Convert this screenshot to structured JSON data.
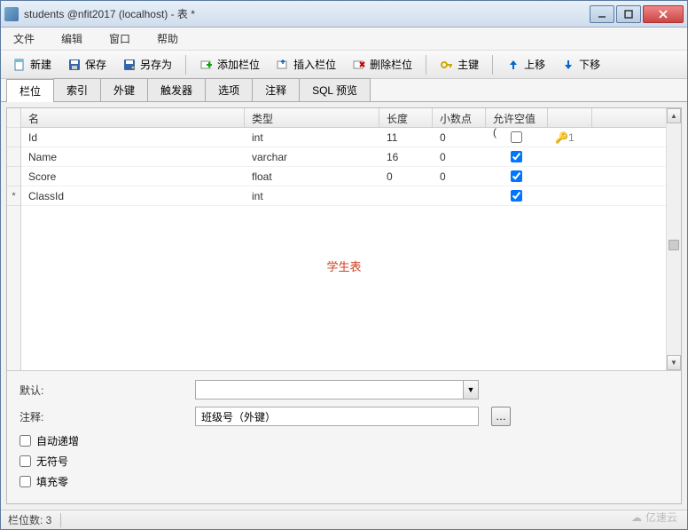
{
  "window": {
    "title": "students @nfit2017 (localhost) - 表 *"
  },
  "menu": {
    "file": "文件",
    "edit": "编辑",
    "window": "窗口",
    "help": "帮助"
  },
  "toolbar": {
    "new": "新建",
    "save": "保存",
    "saveas": "另存为",
    "add_field": "添加栏位",
    "insert_field": "插入栏位",
    "delete_field": "删除栏位",
    "primary_key": "主键",
    "move_up": "上移",
    "move_down": "下移"
  },
  "tabs": {
    "fields": "栏位",
    "indexes": "索引",
    "foreign_keys": "外键",
    "triggers": "触发器",
    "options": "选项",
    "comment": "注释",
    "sql_preview": "SQL 预览"
  },
  "grid": {
    "headers": {
      "name": "名",
      "type": "类型",
      "length": "长度",
      "decimals": "小数点",
      "allow_null": "允许空值 ("
    },
    "rows": [
      {
        "marker": "",
        "name": "Id",
        "type": "int",
        "length": "11",
        "decimals": "0",
        "allow_null": false,
        "key": "🔑1"
      },
      {
        "marker": "",
        "name": "Name",
        "type": "varchar",
        "length": "16",
        "decimals": "0",
        "allow_null": true,
        "key": ""
      },
      {
        "marker": "",
        "name": "Score",
        "type": "float",
        "length": "0",
        "decimals": "0",
        "allow_null": true,
        "key": ""
      },
      {
        "marker": "*",
        "name": "ClassId",
        "type": "int",
        "length": "",
        "decimals": "",
        "allow_null": true,
        "key": ""
      }
    ],
    "watermark": "学生表"
  },
  "props": {
    "default_label": "默认:",
    "default_value": "",
    "comment_label": "注释:",
    "comment_value": "班级号（外键）",
    "auto_increment": "自动递增",
    "unsigned": "无符号",
    "zerofill": "填充零"
  },
  "status": {
    "field_count": "栏位数: 3"
  },
  "brand": "亿速云"
}
